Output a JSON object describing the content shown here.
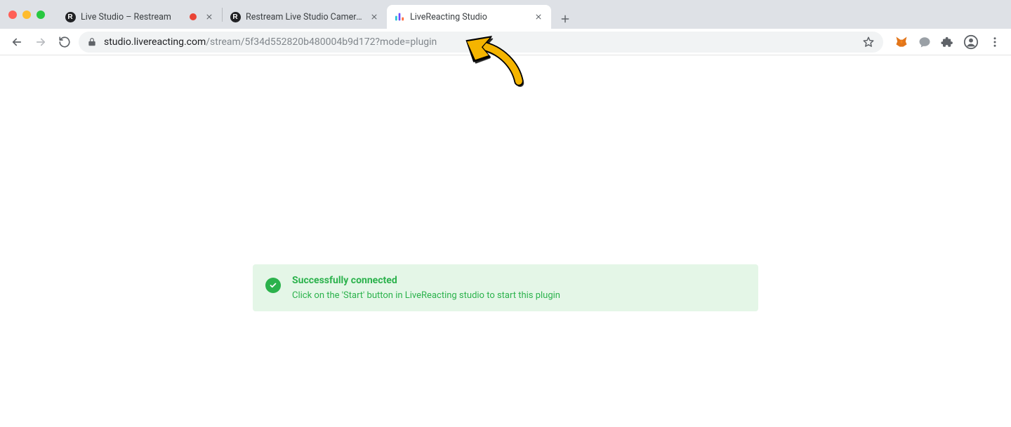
{
  "window": {
    "tabs": [
      {
        "title": "Live Studio – Restream",
        "favicon": "R",
        "recording": true
      },
      {
        "title": "Restream Live Studio Camera F",
        "favicon": "R"
      },
      {
        "title": "LiveReacting Studio",
        "favicon": "livereacting",
        "active": true
      }
    ]
  },
  "toolbar": {
    "url_host": "studio.livereacting.com",
    "url_path": "/stream/5f34d552820b480004b9d172?mode=plugin"
  },
  "alert": {
    "title": "Successfully connected",
    "body": "Click on the 'Start' button in LiveReacting studio to start this plugin"
  }
}
